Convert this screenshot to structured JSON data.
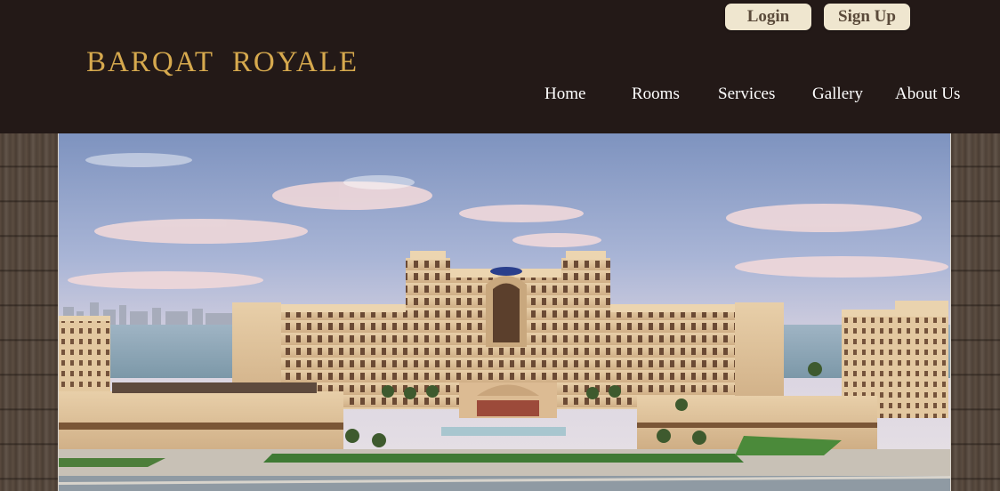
{
  "auth": {
    "login_label": "Login",
    "signup_label": "Sign Up"
  },
  "brand": {
    "logo_text": "BARQAT  ROYALE"
  },
  "nav": {
    "items": [
      {
        "label": "Home"
      },
      {
        "label": "Rooms"
      },
      {
        "label": "Services"
      },
      {
        "label": "Gallery"
      },
      {
        "label": "About Us"
      }
    ]
  },
  "hero": {
    "image": "hotel-building-photo"
  },
  "colors": {
    "header_bg": "#231917",
    "logo_gold": "#d6a94e",
    "button_bg": "#efe6cf",
    "button_text": "#5a4a3a",
    "nav_text": "#ffffff"
  }
}
